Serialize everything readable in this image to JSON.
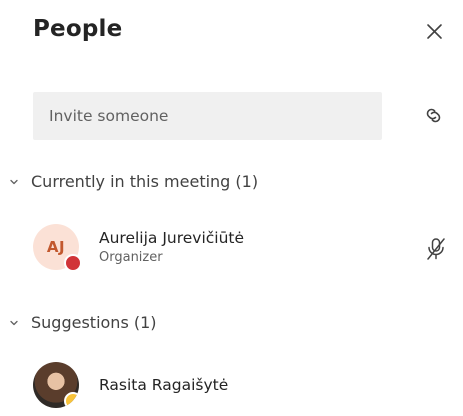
{
  "panel": {
    "title": "People"
  },
  "invite": {
    "placeholder": "Invite someone"
  },
  "sections": [
    {
      "label": "Currently in this meeting (1)",
      "people": [
        {
          "initials": "AJ",
          "name": "Aurelija Jurevičiūtė",
          "role": "Organizer",
          "status": "busy",
          "status_color": "#d13438",
          "mic_icon": "mic-off-icon"
        }
      ]
    },
    {
      "label": "Suggestions (1)",
      "people": [
        {
          "name": "Rasita Ragaišytė",
          "status": "away",
          "status_color": "#f8c33b"
        }
      ]
    }
  ],
  "icons": {
    "close": "close-icon",
    "link": "link-icon",
    "chevron": "chevron-down-icon"
  }
}
